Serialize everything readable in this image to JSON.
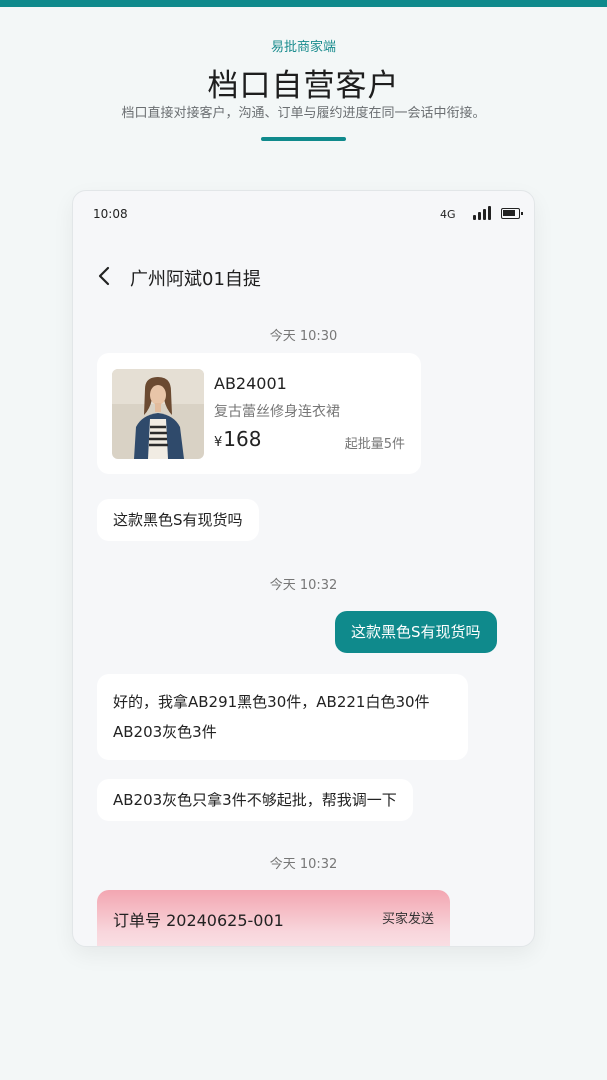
{
  "colors": {
    "accent": "#0f8a8c",
    "order_card": "#f3a6b1"
  },
  "header": {
    "brand": "易批商家端",
    "title": "档口自营客户",
    "subtitle": "档口直接对接客户，沟通、订单与履约进度在同一会话中衔接。"
  },
  "status_bar": {
    "time": "10:08",
    "network": "4G",
    "icons": [
      "signal-icon",
      "battery-icon"
    ]
  },
  "chat": {
    "title": "广州阿斌01自提",
    "back_icon": "chevron-left-icon",
    "timestamps": [
      "今天 10:30",
      "今天 10:32",
      "今天 10:32"
    ],
    "product": {
      "code": "AB24001",
      "name": "复古蕾丝修身连衣裙",
      "currency": "¥",
      "price": "168",
      "moq": "起批量5件"
    },
    "messages": [
      {
        "side": "incoming",
        "text": "这款黑色S有现货吗"
      },
      {
        "side": "outgoing",
        "text": "这款黑色S有现货吗"
      },
      {
        "side": "incoming",
        "lines": [
          "好的，我拿AB291黑色30件，AB221白色30件",
          "AB203灰色3件"
        ]
      },
      {
        "side": "incoming",
        "text": "AB203灰色只拿3件不够起批，帮我调一下"
      }
    ],
    "order": {
      "number": "订单号 20240625-001",
      "sender": "买家发送"
    }
  }
}
